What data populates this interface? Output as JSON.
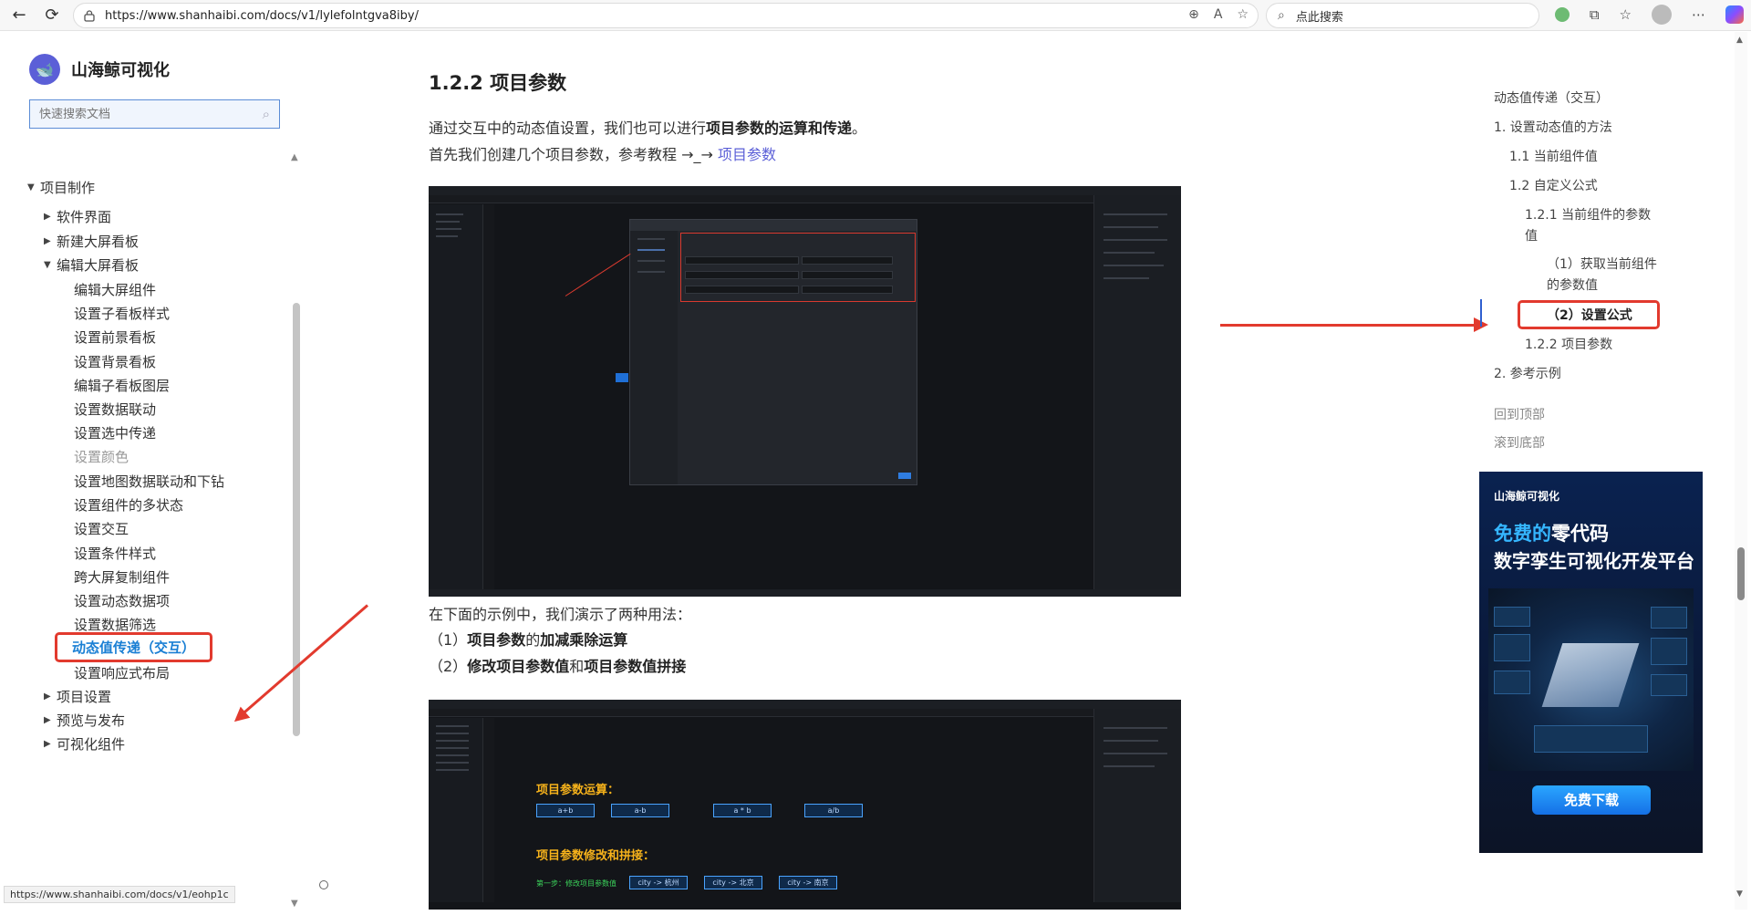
{
  "browser": {
    "url": "https://www.shanhaibi.com/docs/v1/lylefolntgva8iby/",
    "search_placeholder": "点此搜索",
    "status_url": "https://www.shanhaibi.com/docs/v1/eohp1c"
  },
  "sidebar": {
    "brand": "山海鲸可视化",
    "search_placeholder": "快速搜索文档",
    "items": [
      {
        "label": "项目制作",
        "level": 1,
        "expanded": true
      },
      {
        "label": "软件界面",
        "level": 2,
        "expanded": false
      },
      {
        "label": "新建大屏看板",
        "level": 2,
        "expanded": false
      },
      {
        "label": "编辑大屏看板",
        "level": 2,
        "expanded": true
      },
      {
        "label": "编辑大屏组件",
        "level": 3
      },
      {
        "label": "设置子看板样式",
        "level": 3
      },
      {
        "label": "设置前景看板",
        "level": 3
      },
      {
        "label": "设置背景看板",
        "level": 3
      },
      {
        "label": "编辑子看板图层",
        "level": 3
      },
      {
        "label": "设置数据联动",
        "level": 3
      },
      {
        "label": "设置选中传递",
        "level": 3
      },
      {
        "label": "设置颜色",
        "level": 3,
        "muted": true
      },
      {
        "label": "设置地图数据联动和下钻",
        "level": 3
      },
      {
        "label": "设置组件的多状态",
        "level": 3
      },
      {
        "label": "设置交互",
        "level": 3
      },
      {
        "label": "设置条件样式",
        "level": 3
      },
      {
        "label": "跨大屏复制组件",
        "level": 3
      },
      {
        "label": "设置动态数据项",
        "level": 3
      },
      {
        "label": "设置数据筛选",
        "level": 3
      },
      {
        "label": "动态值传递（交互）",
        "level": 3,
        "active": true
      },
      {
        "label": "设置响应式布局",
        "level": 3
      },
      {
        "label": "项目设置",
        "level": 2,
        "expanded": false
      },
      {
        "label": "预览与发布",
        "level": 2,
        "expanded": false
      },
      {
        "label": "可视化组件",
        "level": 2,
        "expanded": false
      }
    ]
  },
  "content": {
    "heading": "1.2.2 项目参数",
    "p1_pre": "通过交互中的动态值设置，我们也可以进行",
    "p1_bold": "项目参数的运算和传递",
    "p1_post": "。",
    "p2_pre": "首先我们创建几个项目参数，参考教程 →_→ ",
    "p2_link": "项目参数",
    "p3": "在下面的示例中，我们演示了两种用法：",
    "li1_num": "（1）",
    "li1_b1": "项目参数",
    "li1_mid": "的",
    "li1_b2": "加减乘除运算",
    "li2_num": "（2）",
    "li2_b1": "修改项目参数值",
    "li2_mid": "和",
    "li2_b2": "项目参数值拼接",
    "shot2": {
      "title1": "项目参数运算：",
      "ops": [
        "a+b",
        "a-b",
        "a * b",
        "a/b"
      ],
      "title2": "项目参数修改和拼接：",
      "step": "第一步：修改项目参数值",
      "cities": [
        "city -> 杭州",
        "city -> 北京",
        "city -> 南京"
      ]
    }
  },
  "toc": {
    "title": "动态值传递（交互）",
    "items": [
      {
        "label": "1. 设置动态值的方法",
        "indent": 0
      },
      {
        "label": "1.1 当前组件值",
        "indent": 1
      },
      {
        "label": "1.2 自定义公式",
        "indent": 1
      },
      {
        "label": "1.2.1 当前组件的参数",
        "indent": 2
      },
      {
        "label": "值",
        "indent": 2
      },
      {
        "label": "（1）获取当前组件",
        "indent": 3
      },
      {
        "label": "的参数值",
        "indent": 3
      },
      {
        "label": "（2）设置公式",
        "indent": 3,
        "active": true
      },
      {
        "label": "1.2.2 项目参数",
        "indent": 2
      },
      {
        "label": "2. 参考示例",
        "indent": 0
      }
    ],
    "back_top": "回到顶部",
    "to_bottom": "滚到底部"
  },
  "ad": {
    "brand": "山海鲸可视化",
    "headline_hl": "免费的",
    "headline_rest": "零代码",
    "subline": "数字孪生可视化开发平台",
    "button": "免费下载"
  },
  "colors": {
    "accent": "#5b5fd7",
    "highlight_red": "#e23a2e",
    "active_link": "#1a7fd4",
    "ad_button": "#1a8cff"
  }
}
